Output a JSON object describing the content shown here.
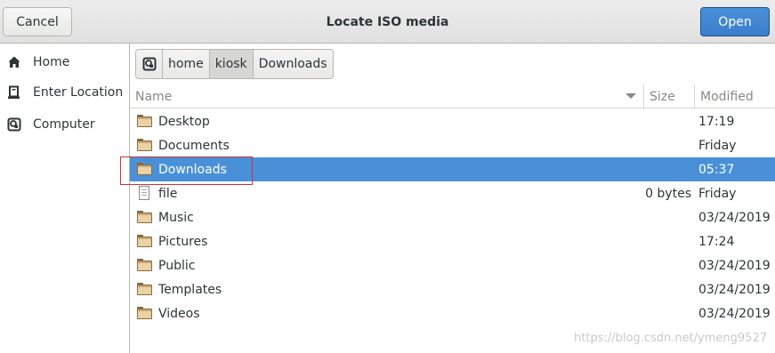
{
  "header": {
    "title": "Locate ISO media",
    "cancel_label": "Cancel",
    "open_label": "Open"
  },
  "sidebar": {
    "items": [
      {
        "label": "Home",
        "icon": "home-icon"
      },
      {
        "label": "Enter Location",
        "icon": "location-icon"
      },
      {
        "label": "Computer",
        "icon": "computer-icon"
      }
    ]
  },
  "pathbar": {
    "root_icon": "drive-icon",
    "segments": [
      "home",
      "kiosk",
      "Downloads"
    ]
  },
  "filelist": {
    "columns": {
      "name": "Name",
      "size": "Size",
      "modified": "Modified"
    },
    "rows": [
      {
        "name": "Desktop",
        "type": "folder",
        "size": "",
        "modified": "17:19"
      },
      {
        "name": "Documents",
        "type": "folder",
        "size": "",
        "modified": "Friday"
      },
      {
        "name": "Downloads",
        "type": "folder",
        "size": "",
        "modified": "05:37",
        "selected": true
      },
      {
        "name": "file",
        "type": "file",
        "size": "0 bytes",
        "modified": "Friday"
      },
      {
        "name": "Music",
        "type": "folder",
        "size": "",
        "modified": "03/24/2019"
      },
      {
        "name": "Pictures",
        "type": "folder",
        "size": "",
        "modified": "17:24"
      },
      {
        "name": "Public",
        "type": "folder",
        "size": "",
        "modified": "03/24/2019"
      },
      {
        "name": "Templates",
        "type": "folder",
        "size": "",
        "modified": "03/24/2019"
      },
      {
        "name": "Videos",
        "type": "folder",
        "size": "",
        "modified": "03/24/2019"
      }
    ]
  },
  "watermark": "https://blog.csdn.net/ymeng9527",
  "colors": {
    "accent": "#4a90d9",
    "highlight_box": "#d03030"
  }
}
